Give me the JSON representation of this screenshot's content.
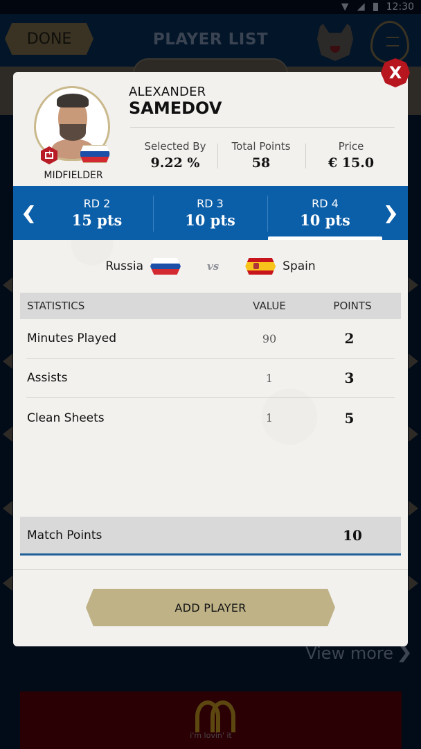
{
  "status_bar": {
    "time": "12:30",
    "icons": [
      "wifi-icon",
      "cellular-signal-icon",
      "battery-icon"
    ]
  },
  "app_header": {
    "done_label": "DONE",
    "title": "PLAYER LIST",
    "mascot_icon": "wolf-mascot-icon",
    "menu_icon": "list-menu-icon"
  },
  "background": {
    "view_more_label": "View more",
    "ad_tagline": "i'm lovin' it",
    "ad_logo": "golden-arches-logo"
  },
  "modal": {
    "close_label": "X",
    "player": {
      "first_name": "ALEXANDER",
      "last_name": "SAMEDOV",
      "position": "MIDFIELDER",
      "country": "Russia",
      "role_icon": "medical-kit-icon"
    },
    "summary": [
      {
        "label": "Selected By",
        "value": "9.22 %"
      },
      {
        "label": "Total Points",
        "value": "58"
      },
      {
        "label": "Price",
        "value": "€ 15.0"
      }
    ],
    "rounds": [
      {
        "round": "RD 2",
        "points": "15 pts",
        "active": false
      },
      {
        "round": "RD 3",
        "points": "10 pts",
        "active": false
      },
      {
        "round": "RD 4",
        "points": "10 pts",
        "active": true
      }
    ],
    "fixture": {
      "home": "Russia",
      "away": "Spain",
      "vs": "vs"
    },
    "stats": {
      "headers": {
        "statistic": "STATISTICS",
        "value": "VALUE",
        "points": "POINTS"
      },
      "rows": [
        {
          "statistic": "Minutes Played",
          "value": "90",
          "points": "2"
        },
        {
          "statistic": "Assists",
          "value": "1",
          "points": "3"
        },
        {
          "statistic": "Clean Sheets",
          "value": "1",
          "points": "5"
        }
      ]
    },
    "match_points": {
      "label": "Match Points",
      "value": "10"
    },
    "add_player_label": "ADD PLAYER"
  },
  "colors": {
    "round_bar_blue": "#0b5ea8",
    "close_red": "#b8161f",
    "gold_button": "#bfb287",
    "modal_bg": "#f2f1ee"
  }
}
